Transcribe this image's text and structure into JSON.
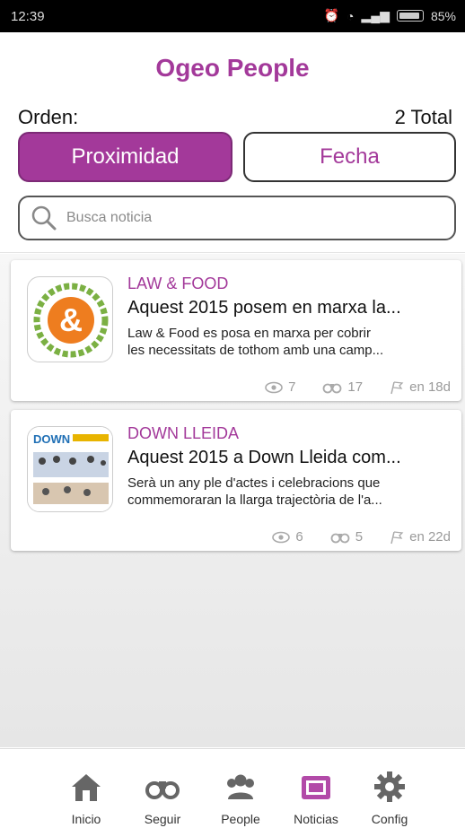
{
  "status_bar": {
    "time": "12:39",
    "battery": "85%"
  },
  "header": {
    "title": "Ogeo People",
    "order_label": "Orden:",
    "total_label": "2 Total",
    "sort_options": [
      "Proximidad",
      "Fecha"
    ],
    "selected_sort": "Proximidad",
    "search_placeholder": "Busca noticia"
  },
  "news": [
    {
      "category": "LAW & FOOD",
      "title": "Aquest 2015 posem en marxa la...",
      "description_lines": [
        "Law & Food es posa en marxa per cobrir",
        "les necessitats de tothom amb una camp..."
      ],
      "views": "7",
      "follows": "17",
      "age": "en 18d"
    },
    {
      "category": "DOWN LLEIDA",
      "title": "Aquest 2015 a Down Lleida com...",
      "description_lines": [
        "Serà un any ple d'actes i celebracions que",
        "commemoraran la llarga trajectòria de l'a..."
      ],
      "views": "6",
      "follows": "5",
      "age": "en 22d"
    }
  ],
  "bottom_nav": [
    {
      "label": "Inicio",
      "icon": "home-icon"
    },
    {
      "label": "Seguir",
      "icon": "binoculars-icon"
    },
    {
      "label": "People",
      "icon": "people-icon"
    },
    {
      "label": "Noticias",
      "icon": "newspaper-icon"
    },
    {
      "label": "Config",
      "icon": "gear-icon"
    }
  ],
  "colors": {
    "accent": "#a3399a",
    "text": "#111111",
    "muted": "#9a9a9a"
  }
}
